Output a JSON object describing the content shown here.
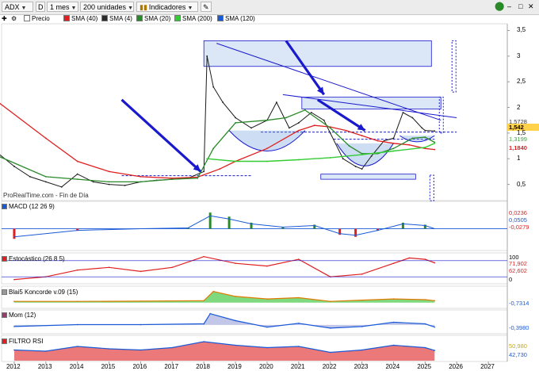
{
  "toolbar": {
    "symbol": "ADX",
    "period_prefix": "D",
    "period": "1 mes",
    "units": "200 unidades",
    "indicators": "Indicadores"
  },
  "legend": {
    "price": "Precio",
    "sma40": "SMA (40)",
    "sma4": "SMA (4)",
    "sma20": "SMA (20)",
    "sma200": "SMA (200)",
    "sma120": "SMA (120)"
  },
  "colors": {
    "sma40": "#e02020",
    "sma4": "#2a2a2a",
    "sma20": "#2a8a2a",
    "sma200": "#33cc33",
    "sma120": "#1a5ad6",
    "arrow": "#1a1acc",
    "price": "#1a1a1a"
  },
  "footer": "ProRealTime.com - Fin de Día",
  "panels": {
    "macd": "MACD (12 26 9)",
    "stoch": "Estocástico (26 8 5)",
    "blai5": "Blai5 Koncorde v.09 (15)",
    "mom": "Mom (12)",
    "rsi": "FILTRO RSI"
  },
  "tags": {
    "price_top": "1,5728",
    "price_last": "1,542",
    "price_sma20": "1,3199",
    "price_sma40": "1,1840",
    "macd_1": "0,0236",
    "macd_2": "0,0505",
    "macd_3": "-0,0279",
    "stoch_top": "100",
    "stoch_1": "71,902",
    "stoch_2": "62,602",
    "stoch_bot": "0",
    "blai_1": "-0,7314",
    "mom_1": "-0,3980",
    "rsi_1": "50,980",
    "rsi_2": "42,730"
  },
  "chart_data": [
    {
      "type": "line",
      "title": "ADX",
      "x_axis": [
        "2012",
        "2013",
        "2014",
        "2015",
        "2016",
        "2017",
        "2018",
        "2019",
        "2020",
        "2021",
        "2022",
        "2023",
        "2024",
        "2025",
        "2026",
        "2027"
      ],
      "y_ticks": [
        "0,5",
        "1",
        "1,5",
        "2",
        "2,5",
        "3",
        "3,5"
      ],
      "ylim": [
        0.2,
        3.6
      ],
      "series": [
        {
          "name": "Precio",
          "x": [
            2011.5,
            2012,
            2012.5,
            2013,
            2013.5,
            2014,
            2014.5,
            2015,
            2015.5,
            2016,
            2016.5,
            2017,
            2017.5,
            2018,
            2018.1,
            2018.3,
            2018.6,
            2019,
            2019.5,
            2020,
            2020.3,
            2020.7,
            2021,
            2021.4,
            2021.8,
            2022,
            2022.4,
            2022.8,
            2023,
            2023.3,
            2023.7,
            2024,
            2024.3,
            2024.6,
            2024.9,
            2025,
            2025.3
          ],
          "values": [
            1.1,
            0.85,
            0.65,
            0.55,
            0.45,
            0.7,
            0.55,
            0.5,
            0.48,
            0.55,
            0.58,
            0.6,
            0.62,
            0.75,
            3.0,
            2.4,
            2.1,
            1.8,
            1.6,
            1.75,
            2.1,
            1.6,
            1.7,
            1.9,
            1.75,
            1.5,
            1.0,
            0.85,
            0.8,
            1.05,
            1.35,
            1.4,
            1.9,
            1.8,
            1.6,
            1.55,
            1.54
          ]
        },
        {
          "name": "SMA (40)",
          "x": [
            2011.5,
            2013,
            2014,
            2015,
            2016,
            2017,
            2017.8,
            2018.5,
            2019,
            2020,
            2021,
            2021.5,
            2022,
            2022.5,
            2023,
            2023.5,
            2024,
            2024.5,
            2025,
            2025.3
          ],
          "values": [
            2.1,
            1.4,
            0.95,
            0.75,
            0.65,
            0.62,
            0.64,
            0.8,
            0.95,
            1.2,
            1.55,
            1.65,
            1.62,
            1.55,
            1.45,
            1.35,
            1.3,
            1.27,
            1.2,
            1.18
          ]
        },
        {
          "name": "SMA (20)",
          "x": [
            2011.5,
            2013,
            2014,
            2015,
            2016,
            2017,
            2017.8,
            2018.3,
            2019,
            2020,
            2020.6,
            2021.2,
            2022,
            2022.6,
            2023,
            2023.5,
            2024,
            2024.6,
            2025,
            2025.3
          ],
          "values": [
            1.05,
            0.65,
            0.6,
            0.55,
            0.55,
            0.6,
            0.62,
            1.2,
            1.7,
            1.75,
            1.8,
            1.95,
            1.6,
            1.25,
            1.1,
            1.1,
            1.2,
            1.4,
            1.42,
            1.32
          ]
        },
        {
          "name": "SMA (200)",
          "x": [
            2018.1,
            2019,
            2020,
            2021,
            2022,
            2023,
            2024,
            2025,
            2025.3
          ],
          "values": [
            1.0,
            0.95,
            0.95,
            0.98,
            1.02,
            1.08,
            1.15,
            1.22,
            1.3
          ]
        }
      ],
      "annotations": [
        "downtrend line 2018-2025",
        "horizontal resistance 2021-2025",
        "support zone 2022-2025",
        "blue arrows marking breakouts"
      ]
    },
    {
      "type": "bar",
      "title": "MACD (12 26 9)",
      "ylim": [
        -0.1,
        0.12
      ],
      "series": [
        {
          "name": "MACD",
          "x": [
            2012,
            2014,
            2016,
            2017.5,
            2018.2,
            2018.8,
            2019.5,
            2020.5,
            2021.5,
            2022.3,
            2022.8,
            2023.5,
            2024.3,
            2025,
            2025.3
          ],
          "values": [
            -0.05,
            -0.01,
            0.0,
            0.005,
            0.08,
            0.06,
            0.03,
            0.01,
            0.02,
            -0.03,
            -0.04,
            -0.01,
            0.03,
            0.02,
            0.0
          ]
        }
      ]
    },
    {
      "type": "line",
      "title": "Estocástico (26 8 5)",
      "ylim": [
        0,
        100
      ],
      "series": [
        {
          "name": "%K",
          "x": [
            2012,
            2013,
            2014,
            2015,
            2016,
            2017,
            2018,
            2019,
            2020,
            2021,
            2022,
            2023,
            2024,
            2024.5,
            2025,
            2025.3
          ],
          "values": [
            10,
            20,
            45,
            55,
            40,
            55,
            95,
            70,
            60,
            85,
            20,
            30,
            70,
            90,
            85,
            72
          ]
        }
      ]
    },
    {
      "type": "area",
      "title": "Blai5 Koncorde v.09 (15)",
      "ylim": [
        -2,
        6
      ],
      "series": [
        {
          "name": "Koncorde",
          "x": [
            2012,
            2014,
            2016,
            2018,
            2018.3,
            2019,
            2020,
            2021,
            2022,
            2023,
            2024,
            2025,
            2025.3
          ],
          "values": [
            0.5,
            0.5,
            0.6,
            0.8,
            4.5,
            2.5,
            1.5,
            2.0,
            0.5,
            1.0,
            1.5,
            1.2,
            0.8
          ]
        }
      ]
    },
    {
      "type": "line",
      "title": "Mom (12)",
      "ylim": [
        -1.5,
        2.5
      ],
      "series": [
        {
          "name": "Mom",
          "x": [
            2012,
            2014,
            2016,
            2018,
            2018.2,
            2019,
            2020,
            2021,
            2022,
            2023,
            2024,
            2025,
            2025.3
          ],
          "values": [
            -0.3,
            0.05,
            0.05,
            0.2,
            2.1,
            0.8,
            -0.4,
            0.3,
            -0.6,
            -0.3,
            0.5,
            0.2,
            -0.4
          ]
        }
      ]
    },
    {
      "type": "line",
      "title": "FILTRO RSI",
      "ylim": [
        0,
        100
      ],
      "series": [
        {
          "name": "RSI",
          "x": [
            2012,
            2013,
            2014,
            2015,
            2016,
            2017,
            2018,
            2019,
            2020,
            2021,
            2022,
            2023,
            2024,
            2025,
            2025.3
          ],
          "values": [
            45,
            40,
            60,
            50,
            45,
            55,
            80,
            65,
            55,
            60,
            35,
            45,
            65,
            55,
            43
          ]
        }
      ]
    }
  ]
}
